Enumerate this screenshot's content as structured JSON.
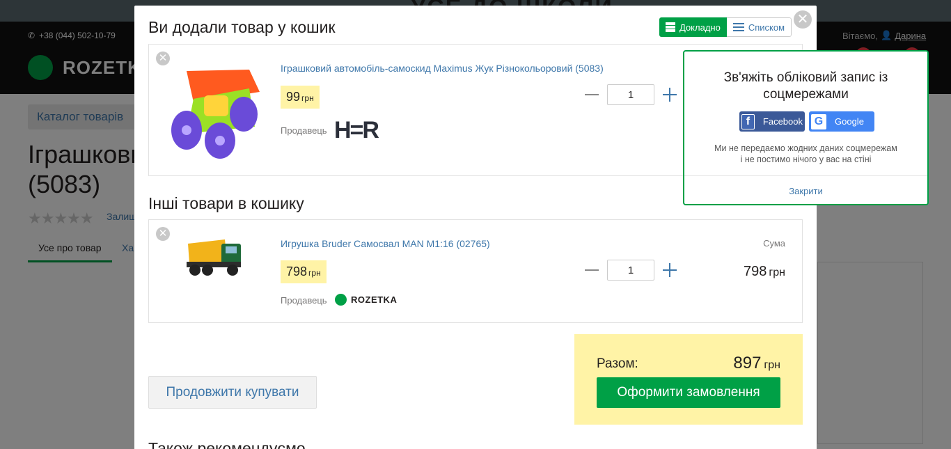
{
  "background": {
    "banner_text": "УСЕ ДО ШКОЛИ",
    "phone": "+38 (044) 502-10-79",
    "logo_text": "ROZETKA",
    "greeting": "Вітаємо,",
    "user_name": "Дарина",
    "catalog_button": "Каталог товарів",
    "product_title_line1": "Іграшковий",
    "product_title_line2": "(5083)",
    "review_link": "Залишити відгук",
    "tab_all": "Усе про товар",
    "tab_specs": "Характеристики"
  },
  "modal": {
    "title": "Ви додали товар у кошик",
    "view_detailed": "Докладно",
    "view_list": "Списком",
    "currency": "грн",
    "seller_label": "Продавець",
    "sum_label": "Сума",
    "added_item": {
      "name": "Іграшковий автомобіль-самоскид Maximus Жук Різнокольоровий (5083)",
      "price": "99",
      "quantity": "1",
      "seller_logo_text": "H=R"
    },
    "other_title": "Інші товари в кошику",
    "other_items": [
      {
        "name": "Игрушка Bruder Самосвал MAN M1:16 (02765)",
        "price": "798",
        "quantity": "1",
        "sum": "798",
        "seller_logo_text": "ROZETKA"
      }
    ],
    "continue_button": "Продовжити купувати",
    "total_label": "Разом:",
    "total_value": "897",
    "checkout_button": "Оформити замовлення",
    "also_recommend": "Також рекомендуємо"
  },
  "social_popup": {
    "title": "Зв'яжіть обліковий запис із соцмережами",
    "facebook": "Facebook",
    "google": "Google",
    "note_line1": "Ми не передаємо жодних даних соцмережам",
    "note_line2": "і не постимо нічого у вас на стіні",
    "close": "Закрити"
  },
  "colors": {
    "accent_green": "#00a046",
    "link_blue": "#3e77aa",
    "price_yellow": "#fff3a6",
    "facebook_blue": "#3b5998",
    "google_blue": "#4285f4"
  }
}
